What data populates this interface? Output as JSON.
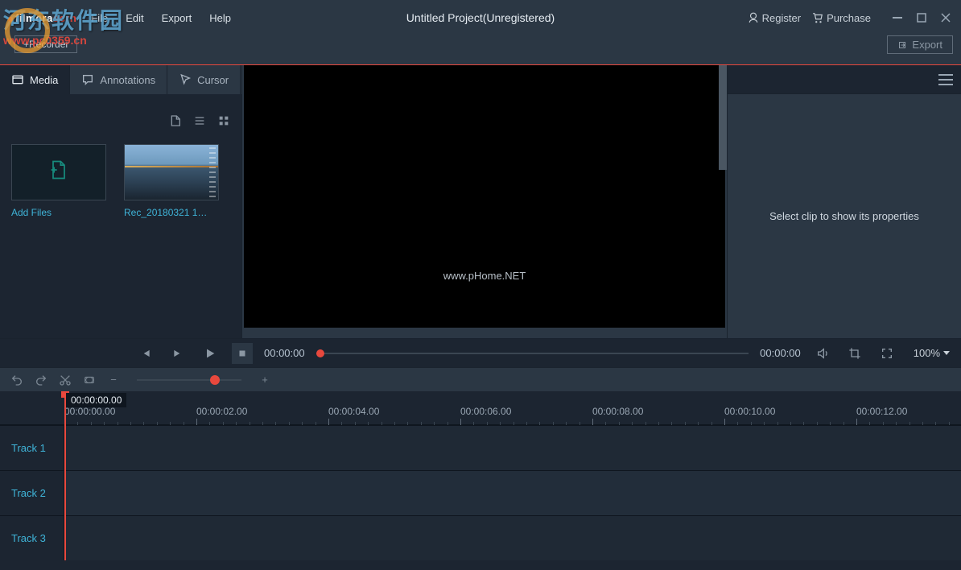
{
  "logo": {
    "prefix": "filmora",
    "suffix": "scrn"
  },
  "menus": {
    "file": "File",
    "edit": "Edit",
    "export": "Export",
    "help": "Help"
  },
  "title": "Untitled Project(Unregistered)",
  "top_right": {
    "register": "Register",
    "purchase": "Purchase"
  },
  "recorder_btn": "+Recorder",
  "export_btn": "Export",
  "watermark": {
    "ch": "河东软件园",
    "en": "www.pc0359.cn"
  },
  "panel_tabs": {
    "media": "Media",
    "annotations": "Annotations",
    "cursor": "Cursor"
  },
  "media_items": [
    {
      "label": "Add Files"
    },
    {
      "label": "Rec_20180321 1…"
    }
  ],
  "preview_watermark": "www.pHome.NET",
  "playback": {
    "current": "00:00:00",
    "total": "00:00:00",
    "zoom": "100%"
  },
  "props_placeholder": "Select clip to show its properties",
  "playhead_time": "00:00:00.00",
  "ruler_labels": [
    "00:00:00.00",
    "00:00:02.00",
    "00:00:04.00",
    "00:00:06.00",
    "00:00:08.00",
    "00:00:10.00",
    "00:00:12.00"
  ],
  "tracks": [
    "Track 1",
    "Track 2",
    "Track 3"
  ]
}
